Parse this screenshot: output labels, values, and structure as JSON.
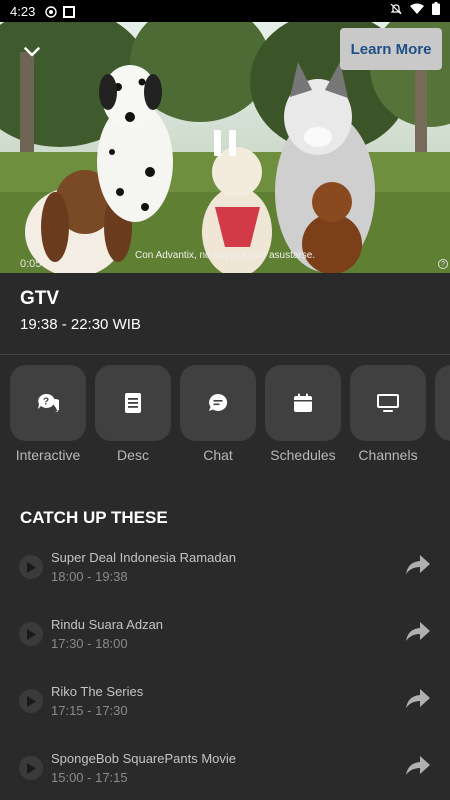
{
  "status_bar": {
    "time": "4:23"
  },
  "video": {
    "learn_more_label": "Learn More",
    "elapsed": "0:05",
    "subtitle": "Con Advantix, no hay por qué asustarse."
  },
  "channel": {
    "name": "GTV",
    "time": "19:38 - 22:30 WIB"
  },
  "menu": {
    "items": [
      {
        "label": "Interactive",
        "icon": "question-chat-icon"
      },
      {
        "label": "Desc",
        "icon": "document-icon"
      },
      {
        "label": "Chat",
        "icon": "chat-bubble-icon"
      },
      {
        "label": "Schedules",
        "icon": "calendar-icon"
      },
      {
        "label": "Channels",
        "icon": "tv-icon"
      }
    ]
  },
  "catchup": {
    "title": "CATCH UP THESE",
    "items": [
      {
        "title": "Super Deal Indonesia Ramadan",
        "time": "18:00 - 19:38"
      },
      {
        "title": "Rindu Suara Adzan",
        "time": "17:30 - 18:00"
      },
      {
        "title": "Riko The Series",
        "time": "17:15 - 17:30"
      },
      {
        "title": "SpongeBob SquarePants Movie",
        "time": "15:00 - 17:15"
      }
    ]
  },
  "colors": {
    "background": "#2a2a2a",
    "tile": "#404040",
    "learn_more_bg": "#c9c9c9",
    "learn_more_text": "#1f4f86"
  }
}
